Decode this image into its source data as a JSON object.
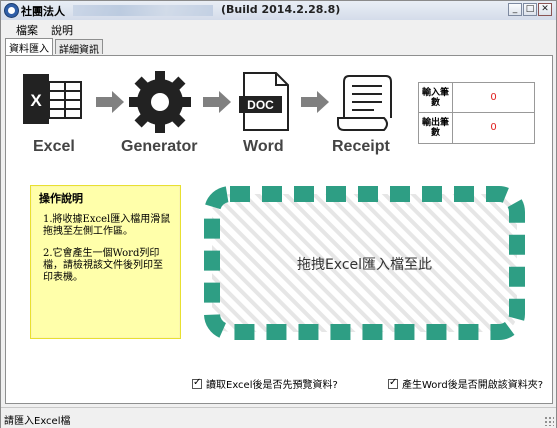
{
  "window": {
    "title": "社團法人",
    "build": "(Build 2014.2.28.8)",
    "controls": [
      "minimize",
      "maximize",
      "close"
    ]
  },
  "menu": {
    "items": [
      "檔案",
      "說明"
    ]
  },
  "tabs": [
    {
      "label": "資料匯入",
      "active": true
    },
    {
      "label": "詳細資訊",
      "active": false
    }
  ],
  "flow": {
    "steps": [
      {
        "label": "Excel",
        "icon": "excel-icon"
      },
      {
        "label": "Generator",
        "icon": "gear-icon"
      },
      {
        "label": "Word",
        "icon": "doc-file-icon",
        "badge": "DOC"
      },
      {
        "label": "Receipt",
        "icon": "receipt-icon"
      }
    ],
    "arrow_icon": "arrow-right-icon"
  },
  "counts": {
    "input_label": "輸入筆數",
    "input_value": "0",
    "output_label": "輸出筆數",
    "output_value": "0",
    "value_color": "#e02020"
  },
  "instructions": {
    "title": "操作說明",
    "p1": "1.將收據Excel匯入檔用滑鼠拖拽至左側工作區。",
    "p2": "2.它會產生一個Word列印檔，請檢視該文件後列印至印表機。"
  },
  "dropzone": {
    "text": "拖拽Excel匯入檔至此",
    "border_color": "#2e9e84"
  },
  "options": {
    "preview": {
      "label": "讀取Excel後是否先預覽資料?",
      "checked": true
    },
    "open_word": {
      "label": "產生Word後是否開啟該資料夾?",
      "checked": true
    }
  },
  "status": {
    "text": "請匯入Excel檔"
  },
  "colors": {
    "icon_dark": "#222222",
    "arrow": "#808080",
    "panel_yellow": "#ffffaa"
  }
}
